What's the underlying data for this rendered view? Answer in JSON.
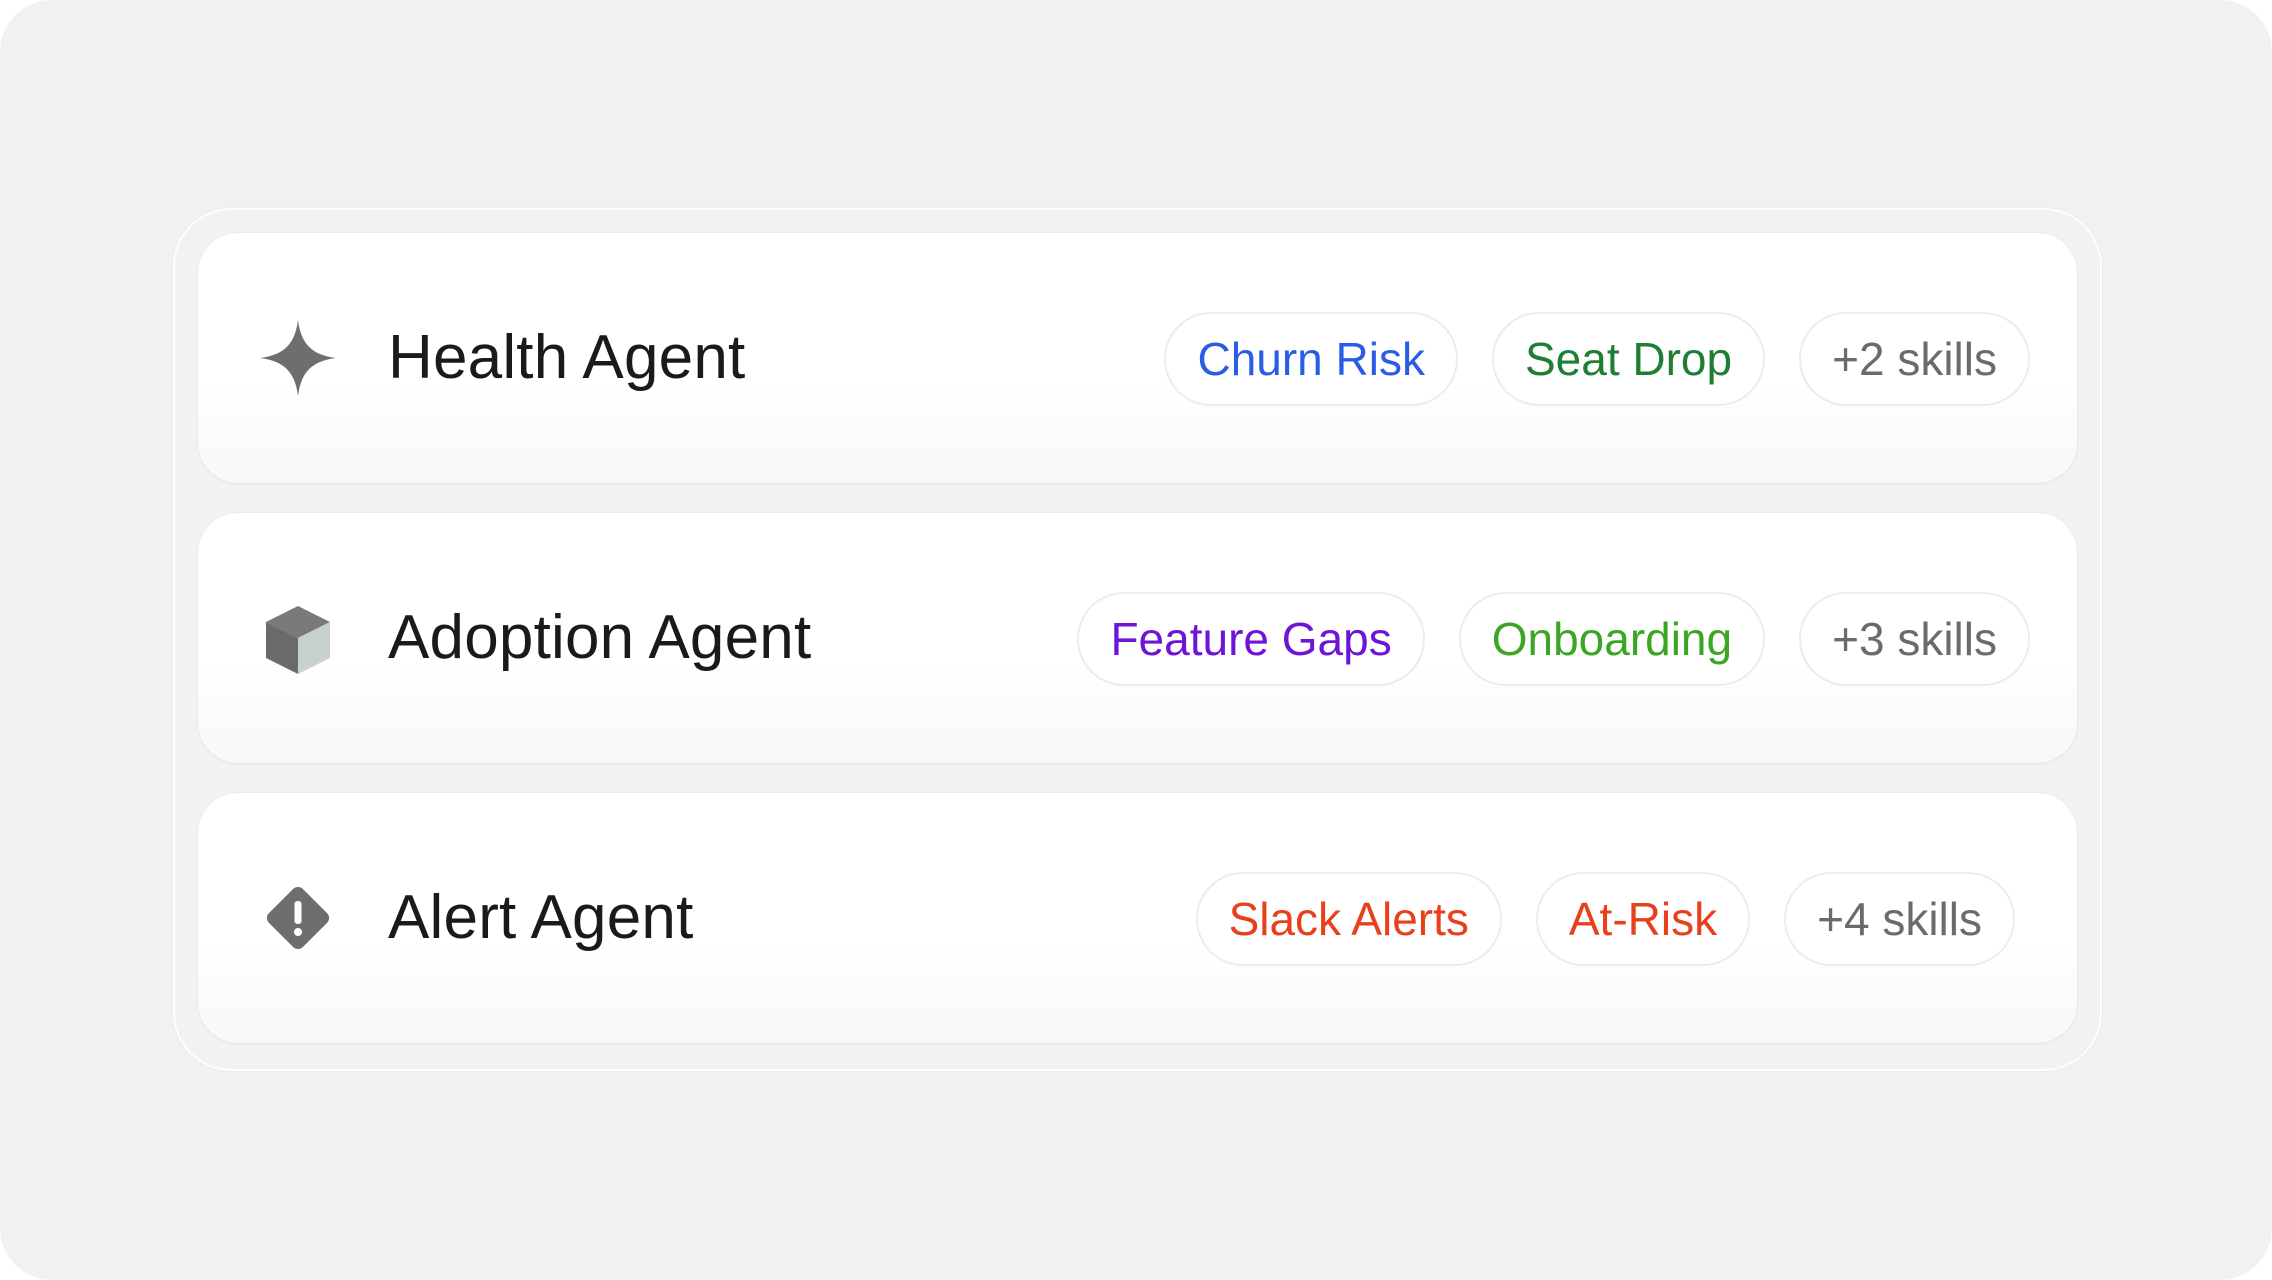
{
  "agents": [
    {
      "title": "Health Agent",
      "icon": "sparkle-icon",
      "icon_color": "#6e6e6e",
      "chips": [
        {
          "label": "Churn Risk",
          "color": "#2b5ce6"
        },
        {
          "label": "Seat Drop",
          "color": "#1e7e34"
        },
        {
          "label": "+2 skills",
          "color": "#6b6b6b"
        }
      ]
    },
    {
      "title": "Adoption Agent",
      "icon": "cube-icon",
      "icon_color": "#6e6e6e",
      "chips": [
        {
          "label": "Feature Gaps",
          "color": "#6d14d6"
        },
        {
          "label": "Onboarding",
          "color": "#3aa624"
        },
        {
          "label": "+3 skills",
          "color": "#6b6b6b"
        }
      ]
    },
    {
      "title": "Alert Agent",
      "icon": "alert-diamond-icon",
      "icon_color": "#6e6e6e",
      "chips": [
        {
          "label": "Slack Alerts",
          "color": "#e8401c"
        },
        {
          "label": "At-Risk",
          "color": "#e8401c"
        },
        {
          "label": "+4 skills",
          "color": "#6b6b6b"
        }
      ]
    }
  ]
}
